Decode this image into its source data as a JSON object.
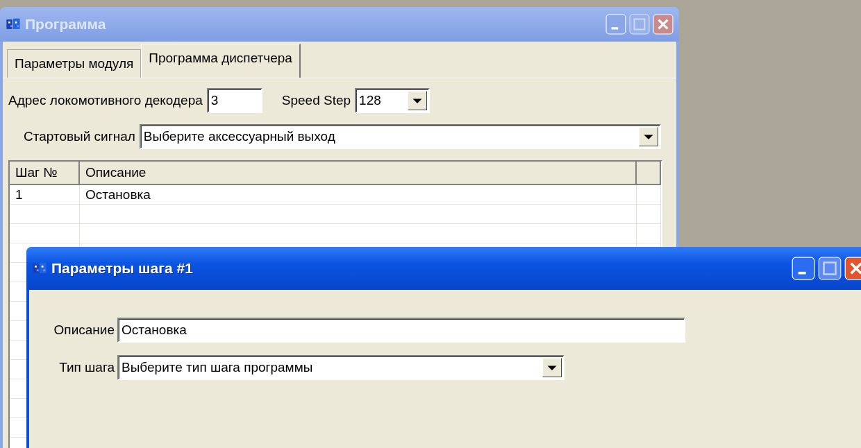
{
  "main_window": {
    "title": "Программа",
    "active": false,
    "tabs": [
      {
        "label": "Параметры модуля",
        "selected": false
      },
      {
        "label": "Программа диспетчера",
        "selected": true
      }
    ],
    "decoder_address": {
      "label": "Адрес локомотивного декодера",
      "value": "3"
    },
    "speed_step": {
      "label": "Speed Step",
      "value": "128"
    },
    "start_signal": {
      "label": "Стартовый сигнал",
      "value": "Выберите аксессуарный выход"
    },
    "table": {
      "columns": [
        "Шаг №",
        "Описание"
      ],
      "rows": [
        [
          "1",
          "Остановка"
        ]
      ]
    }
  },
  "dialog": {
    "title": "Параметры шага #1",
    "active": true,
    "description": {
      "label": "Описание",
      "value": "Остановка"
    },
    "step_type": {
      "label": "Тип шага",
      "value": "Выберите тип шага программы"
    }
  }
}
